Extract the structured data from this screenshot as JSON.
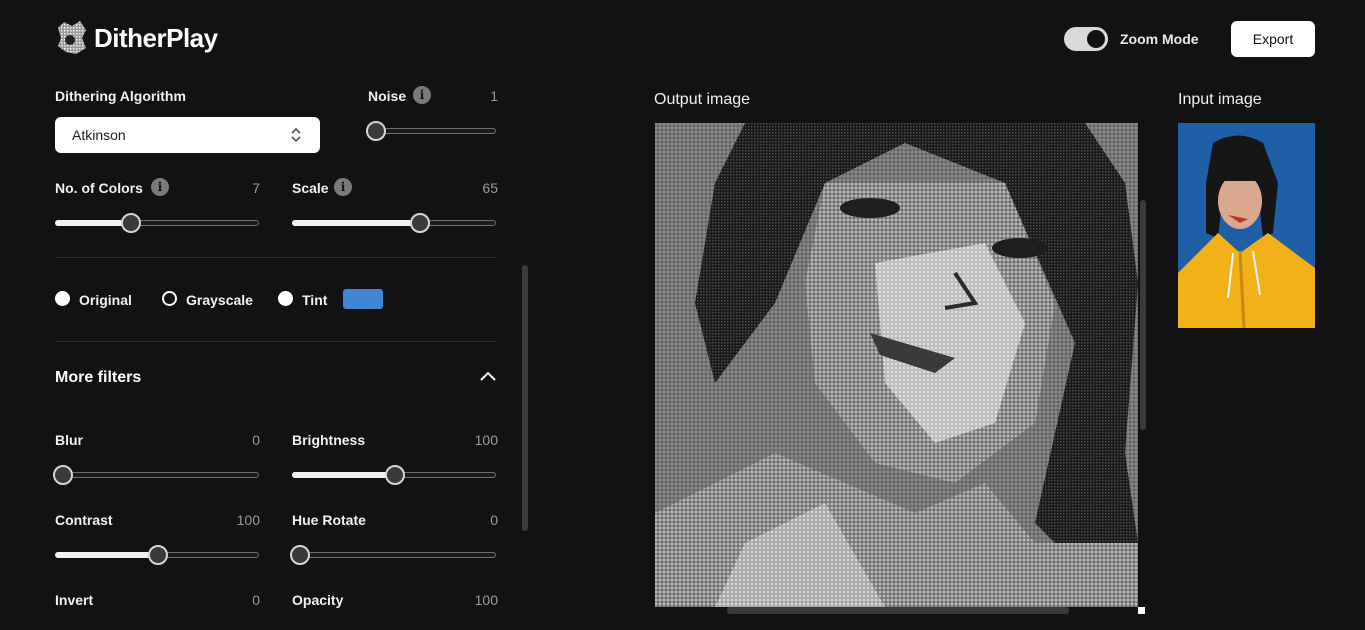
{
  "app": {
    "name": "DitherPlay"
  },
  "header": {
    "zoom_mode_label": "Zoom Mode",
    "zoom_mode_on": true,
    "export_label": "Export"
  },
  "controls": {
    "algorithm": {
      "label": "Dithering Algorithm",
      "value": "Atkinson"
    },
    "noise": {
      "label": "Noise",
      "value": "1",
      "level": 0.0
    },
    "colors": {
      "label": "No. of Colors",
      "value": "7",
      "level": 0.37
    },
    "scale": {
      "label": "Scale",
      "value": "65",
      "level": 0.62
    },
    "color_mode": {
      "options": [
        {
          "label": "Original",
          "selected": true
        },
        {
          "label": "Grayscale",
          "selected": false
        },
        {
          "label": "Tint",
          "selected": true
        }
      ],
      "tint_color": "#4285d4"
    },
    "more_filters": {
      "title": "More filters",
      "expanded": true,
      "blur": {
        "label": "Blur",
        "value": "0",
        "level": 0.0
      },
      "brightness": {
        "label": "Brightness",
        "value": "100",
        "level": 0.5
      },
      "contrast": {
        "label": "Contrast",
        "value": "100",
        "level": 0.5
      },
      "hue_rotate": {
        "label": "Hue Rotate",
        "value": "0",
        "level": 0.0
      },
      "invert": {
        "label": "Invert",
        "value": "0"
      },
      "opacity": {
        "label": "Opacity",
        "value": "100"
      }
    }
  },
  "preview": {
    "output_label": "Output image",
    "input_label": "Input image"
  },
  "icons": {
    "info": "info-icon",
    "select_chevron": "chevron-updown-icon",
    "collapse": "chevron-up-icon"
  }
}
